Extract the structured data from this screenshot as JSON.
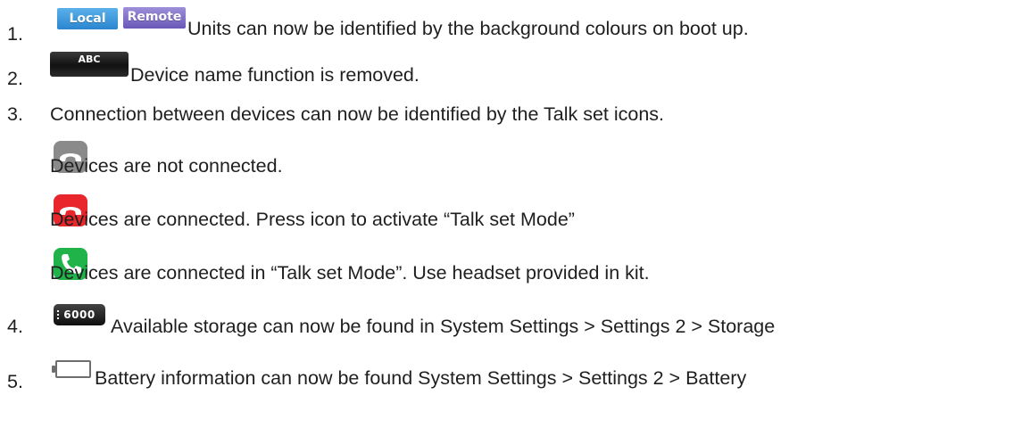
{
  "items": [
    {
      "number": "1.",
      "badges": [
        "Local",
        "Remote"
      ],
      "text": "Units can now be identified by the background colours on boot up."
    },
    {
      "number": "2.",
      "badges": [
        "ABC"
      ],
      "text": "Device name function is removed."
    },
    {
      "number": "3.",
      "text": "Connection between devices can now be identified by the Talk set icons.",
      "subitems": [
        {
          "icon": "phone-grey-icon",
          "color": "#8a8a8a",
          "text": "Devices are not connected."
        },
        {
          "icon": "phone-red-icon",
          "color": "#e8262c",
          "text": "Devices are connected. Press icon to activate “Talk set Mode”"
        },
        {
          "icon": "phone-green-icon",
          "color": "#1fb34a",
          "text": "Devices are connected in “Talk set Mode”. Use headset provided in kit."
        }
      ]
    },
    {
      "number": "4.",
      "badges": [
        "6000"
      ],
      "text": "Available storage can now be found in System Settings > Settings 2 > Storage"
    },
    {
      "number": "5.",
      "icon": "battery-icon",
      "text": "Battery information can now be found System Settings > Settings 2 > Battery"
    }
  ]
}
